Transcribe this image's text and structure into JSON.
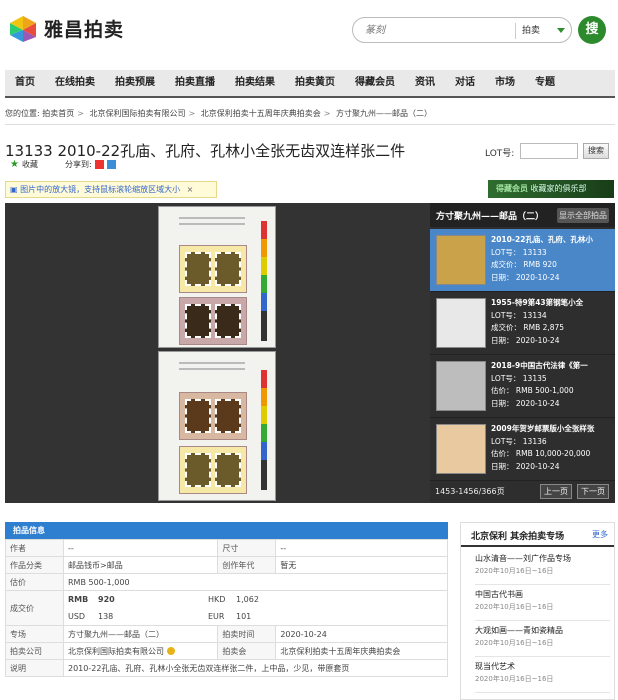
{
  "header": {
    "logo_text": "雅昌拍卖",
    "search_placeholder": "篆刻",
    "search_category": "拍卖",
    "search_button": "搜"
  },
  "nav": [
    "首页",
    "在线拍卖",
    "拍卖预展",
    "拍卖直播",
    "拍卖结果",
    "拍卖黄页",
    "得藏会员",
    "资讯",
    "对话",
    "市场",
    "专题"
  ],
  "breadcrumb": {
    "lead": "您的位置:",
    "items": [
      "拍卖首页",
      "北京保利国际拍卖有限公司",
      "北京保利拍卖十五周年庆典拍卖会",
      "方寸聚九州——邮品（二）"
    ]
  },
  "lot": {
    "title": "13133 2010-22孔庙、孔府、孔林小全张无齿双连样张二件",
    "lot_label": "LOT号:",
    "search_btn": "搜索",
    "collect": "收藏",
    "share": "分享到:"
  },
  "tip": {
    "text": "图片中的放大镜，支持鼠标滚轮缩放区域大小",
    "close": "×"
  },
  "member_banner": {
    "brand": "得藏会员",
    "slogan": "收藏家的俱乐部"
  },
  "sidebar": {
    "title": "方寸聚九州——邮品（二）",
    "show_all": "显示全部拍品",
    "items": [
      {
        "title": "2010-22孔庙、孔府、孔林小",
        "lot": "LOT号： 13133",
        "price": "成交价： RMB 920",
        "date": "日期： 2020-10-24"
      },
      {
        "title": "1955-特9第43第钢笔小全",
        "lot": "LOT号： 13134",
        "price": "成交价： RMB 2,875",
        "date": "日期： 2020-10-24"
      },
      {
        "title": "2018-9中国古代法律《第一",
        "lot": "LOT号： 13135",
        "price": "估价： RMB 500-1,000",
        "date": "日期： 2020-10-24"
      },
      {
        "title": "2009年贺岁邮票版小全张样张",
        "lot": "LOT号： 13136",
        "price": "估价： RMB 10,000-20,000",
        "date": "日期： 2020-10-24"
      }
    ],
    "page_count": "1453-1456/366页",
    "prev": "上一页",
    "next": "下一页"
  },
  "info": {
    "heading": "拍品信息",
    "author_label": "作者",
    "author": "--",
    "size_label": "尺寸",
    "size": "--",
    "category_label": "作品分类",
    "category": "邮品钱币>邮品",
    "year_label": "创作年代",
    "year": "暂无",
    "estimate_label": "估价",
    "estimate": "RMB  500-1,000",
    "deal_label": "成交价",
    "deal": {
      "rmb_label": "RMB",
      "rmb": "920",
      "hkd_label": "HKD",
      "hkd": "1,062",
      "usd_label": "USD",
      "usd": "138",
      "eur_label": "EUR",
      "eur": "101"
    },
    "session_label": "专场",
    "session": "方寸聚九州——邮品（二）",
    "time_label": "拍卖时间",
    "time": "2020-10-24",
    "company_label": "拍卖公司",
    "company": "北京保利国际拍卖有限公司",
    "auction_label": "拍卖会",
    "auction": "北京保利拍卖十五周年庆典拍卖会",
    "desc_label": "说明",
    "desc": "2010-22孔庙、孔府、孔林小全张无齿双连样张二件，上中品，少见，带原套页"
  },
  "right_panel": {
    "title": "北京保利 其余拍卖专场",
    "more": "更多",
    "items": [
      {
        "name": "山水清音——刘广作品专场",
        "date": "2020年10月16日~16日"
      },
      {
        "name": "中国古代书画",
        "date": "2020年10月16日~16日"
      },
      {
        "name": "大观如画——青如瓷精品",
        "date": "2020年10月16日~16日"
      },
      {
        "name": "现当代艺术",
        "date": "2020年10月16日~16日"
      }
    ]
  },
  "colors": {
    "accent_blue": "#2f7fd0",
    "brand_green": "#2c8a2c",
    "estimate_red": "#c33333"
  }
}
